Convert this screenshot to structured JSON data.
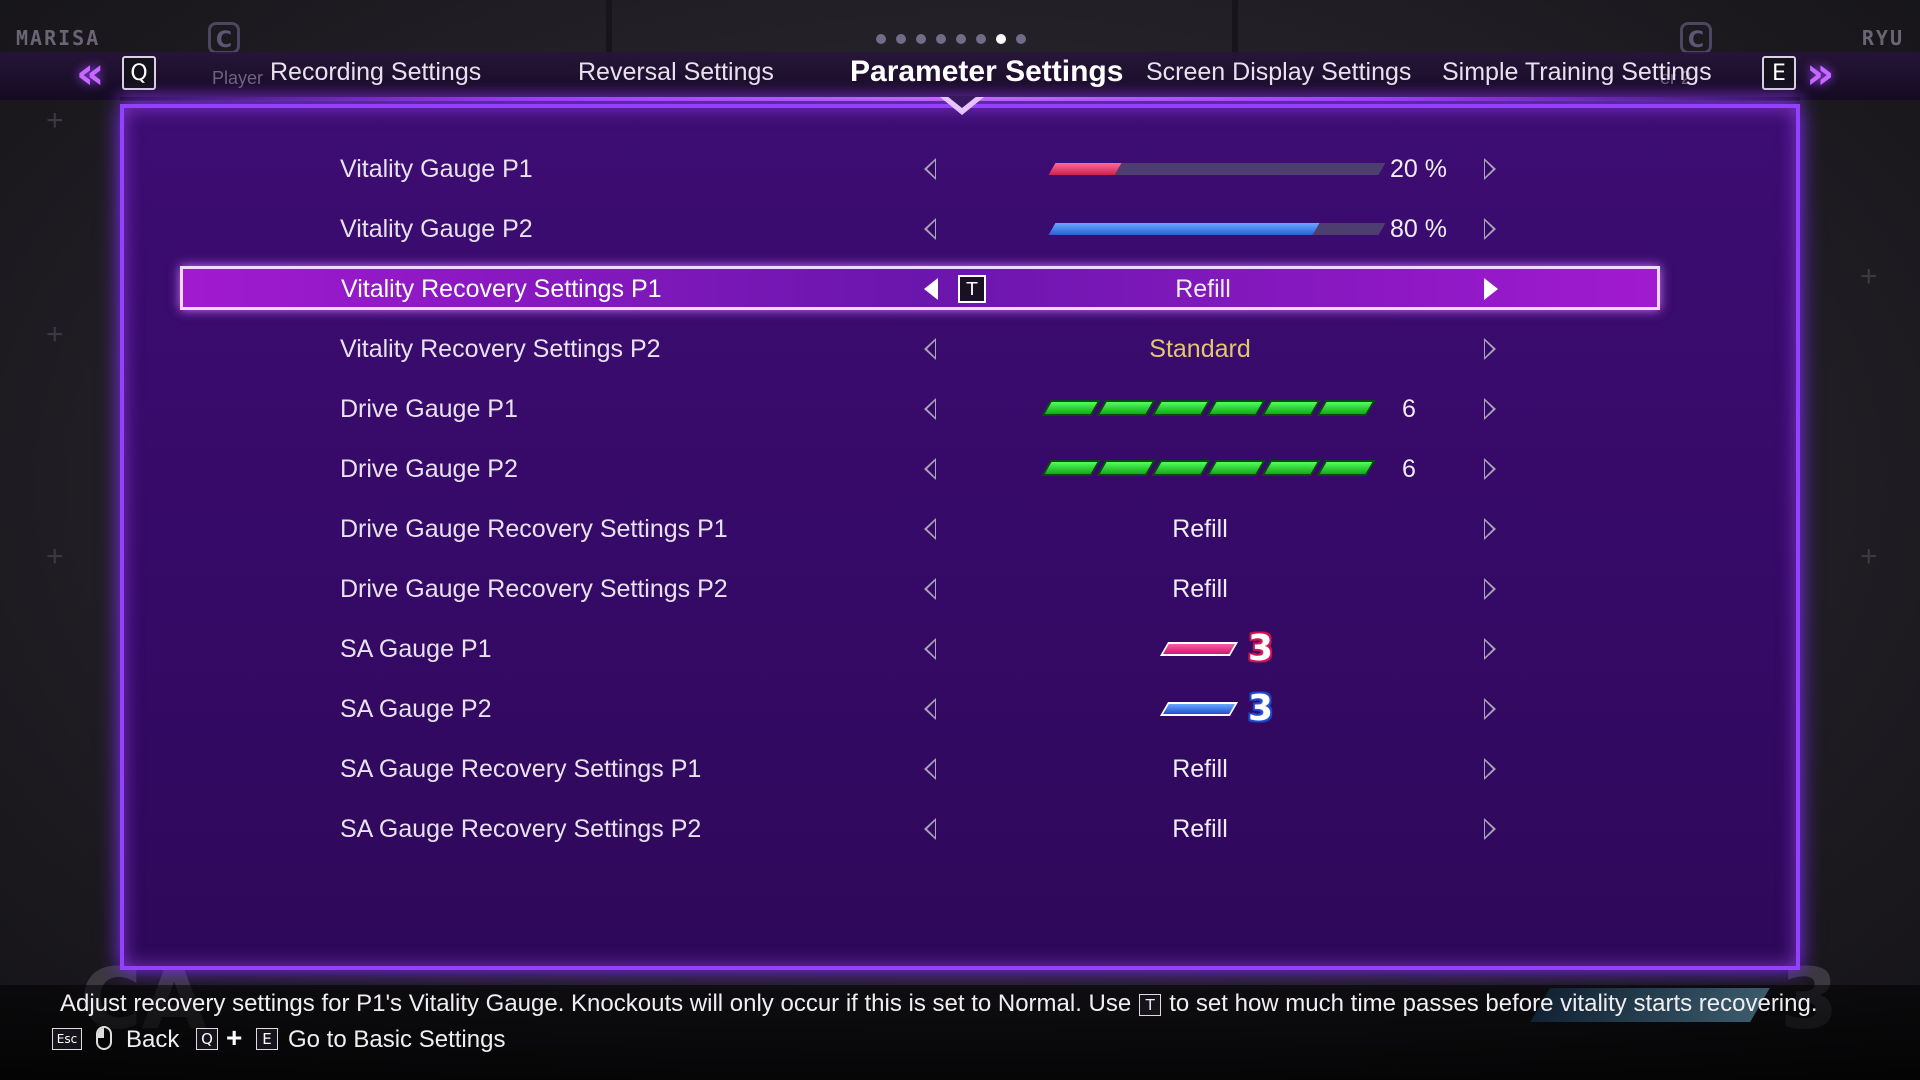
{
  "hud": {
    "left_player": "MARISA",
    "right_player": "RYU",
    "left_badge": "C",
    "right_badge": "C",
    "bg_mark_left": "CA",
    "bg_mark_right": "3"
  },
  "tabs": {
    "prev_key": "Q",
    "next_key": "E",
    "ghost_left": "Player",
    "ghost_right": "er 2",
    "items": [
      {
        "label": "Recording Settings",
        "active": false
      },
      {
        "label": "Reversal Settings",
        "active": false
      },
      {
        "label": "Parameter Settings",
        "active": true
      },
      {
        "label": "Screen Display Settings",
        "active": false
      },
      {
        "label": "Simple Training Settings",
        "active": false
      }
    ],
    "page_count": 8,
    "page_index": 6
  },
  "rows": [
    {
      "label": "Vitality Gauge P1",
      "kind": "bar",
      "player": "p1",
      "fill": 0.2,
      "value": "20 %"
    },
    {
      "label": "Vitality Gauge P2",
      "kind": "bar",
      "player": "p2",
      "fill": 0.8,
      "value": "80 %"
    },
    {
      "label": "Vitality Recovery Settings P1",
      "kind": "text",
      "value": "Refill",
      "selected": true,
      "key": "T"
    },
    {
      "label": "Vitality Recovery Settings P2",
      "kind": "text",
      "value": "Standard",
      "highlight": "gold"
    },
    {
      "label": "Drive Gauge P1",
      "kind": "drive",
      "stocks": 6,
      "value": "6"
    },
    {
      "label": "Drive Gauge P2",
      "kind": "drive",
      "stocks": 6,
      "value": "6"
    },
    {
      "label": "Drive Gauge Recovery Settings P1",
      "kind": "text",
      "value": "Refill"
    },
    {
      "label": "Drive Gauge Recovery Settings P2",
      "kind": "text",
      "value": "Refill"
    },
    {
      "label": "SA Gauge P1",
      "kind": "sa",
      "player": "p1",
      "value": "3"
    },
    {
      "label": "SA Gauge P2",
      "kind": "sa",
      "player": "p2",
      "value": "3"
    },
    {
      "label": "SA Gauge Recovery Settings P1",
      "kind": "text",
      "value": "Refill"
    },
    {
      "label": "SA Gauge Recovery Settings P2",
      "kind": "text",
      "value": "Refill"
    }
  ],
  "footer": {
    "help_before": "Adjust recovery settings for P1's Vitality Gauge. Knockouts will only occur if this is set to Normal. Use",
    "help_key": "T",
    "help_after": "to set how much time passes before vitality starts recovering.",
    "back_key": "Esc",
    "back_label": "Back",
    "basic_key1": "Q",
    "basic_key2": "E",
    "basic_label": "Go to Basic Settings"
  },
  "colors": {
    "panel": "#360a68",
    "accent": "#9440ff",
    "p1": "#e0285a",
    "p2": "#3a6ee0",
    "drive": "#2ed836",
    "gold": "#e2c86a"
  }
}
